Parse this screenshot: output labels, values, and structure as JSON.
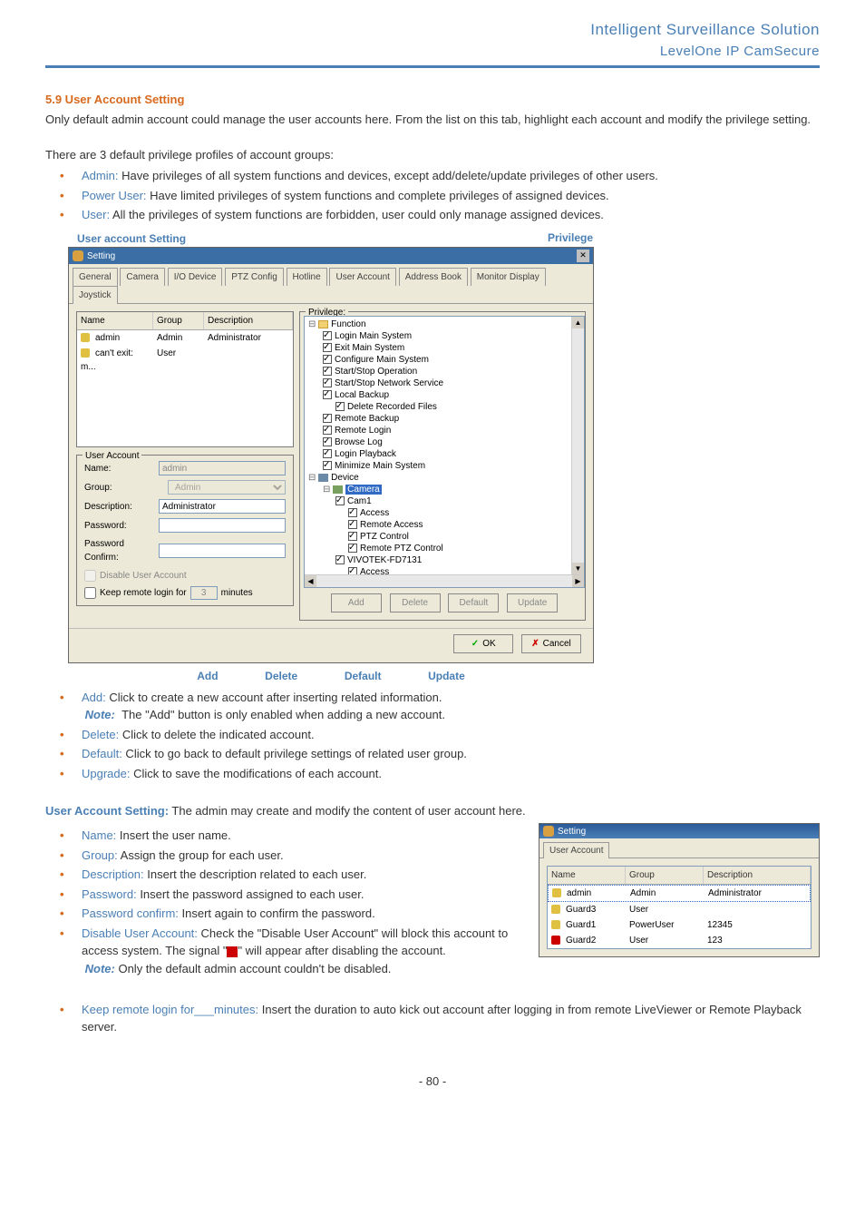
{
  "header": {
    "title": "Intelligent Surveillance Solution",
    "subtitle": "LevelOne IP CamSecure"
  },
  "section": {
    "heading": "5.9 User Account Setting",
    "intro": "Only default admin account could manage the user accounts here. From the list on this tab, highlight each account and modify the privilege setting.",
    "groups_intro": "There are 3 default privilege profiles of account groups:",
    "groups": [
      {
        "name": "Admin:",
        "desc": " Have privileges of all system functions and devices, except add/delete/update privileges of other users."
      },
      {
        "name": "Power User:",
        "desc": " Have limited privileges of system functions and complete privileges of assigned devices."
      },
      {
        "name": "User:",
        "desc": " All the privileges of system functions are forbidden, user could only manage assigned devices."
      }
    ]
  },
  "fig_labels": {
    "uas": "User account Setting",
    "priv": "Privilege",
    "add": "Add",
    "del": "Delete",
    "def": "Default",
    "upd": "Update"
  },
  "dialog": {
    "title": "Setting",
    "close": "✕",
    "tabs": [
      "General",
      "Camera",
      "I/O Device",
      "PTZ Config",
      "Hotline",
      "User Account",
      "Address Book",
      "Monitor Display",
      "Joystick"
    ],
    "active_tab": 5,
    "list": {
      "headers": {
        "name": "Name",
        "group": "Group",
        "desc": "Description"
      },
      "rows": [
        {
          "name": "admin",
          "group": "Admin",
          "desc": "Administrator"
        },
        {
          "name": "can't exit: m...",
          "group": "User",
          "desc": ""
        }
      ]
    },
    "form": {
      "legend": "User Account",
      "name_label": "Name:",
      "name_val": "admin",
      "group_label": "Group:",
      "group_val": "Admin",
      "desc_label": "Description:",
      "desc_val": "Administrator",
      "pwd_label": "Password:",
      "pwdc_label": "Password Confirm:",
      "disable_label": "Disable User Account",
      "keep_label_pre": "Keep remote login for",
      "keep_val": "3",
      "keep_label_post": "minutes"
    },
    "privilege": {
      "legend": "Privilege:",
      "tree": [
        {
          "indent": 0,
          "type": "folder",
          "label": "Function",
          "open": true
        },
        {
          "indent": 1,
          "type": "chk",
          "checked": true,
          "label": "Login Main System"
        },
        {
          "indent": 1,
          "type": "chk",
          "checked": true,
          "label": "Exit Main System"
        },
        {
          "indent": 1,
          "type": "chk",
          "checked": true,
          "label": "Configure Main System"
        },
        {
          "indent": 1,
          "type": "chk",
          "checked": true,
          "label": "Start/Stop Operation"
        },
        {
          "indent": 1,
          "type": "chk",
          "checked": true,
          "label": "Start/Stop Network Service"
        },
        {
          "indent": 1,
          "type": "chk",
          "checked": true,
          "label": "Local Backup",
          "open": true
        },
        {
          "indent": 2,
          "type": "chk",
          "checked": true,
          "label": "Delete Recorded Files"
        },
        {
          "indent": 1,
          "type": "chk",
          "checked": true,
          "label": "Remote Backup"
        },
        {
          "indent": 1,
          "type": "chk",
          "checked": true,
          "label": "Remote Login"
        },
        {
          "indent": 1,
          "type": "chk",
          "checked": true,
          "label": "Browse Log"
        },
        {
          "indent": 1,
          "type": "chk",
          "checked": true,
          "label": "Login Playback"
        },
        {
          "indent": 1,
          "type": "chk",
          "checked": true,
          "label": "Minimize Main System"
        },
        {
          "indent": 0,
          "type": "dev",
          "label": "Device",
          "open": true
        },
        {
          "indent": 1,
          "type": "camera",
          "label": "Camera",
          "selected": true
        },
        {
          "indent": 2,
          "type": "chk",
          "checked": true,
          "label": "Cam1",
          "open": true
        },
        {
          "indent": 3,
          "type": "chk",
          "checked": true,
          "label": "Access"
        },
        {
          "indent": 3,
          "type": "chk",
          "checked": true,
          "label": "Remote Access"
        },
        {
          "indent": 3,
          "type": "chk",
          "checked": true,
          "label": "PTZ Control"
        },
        {
          "indent": 3,
          "type": "chk",
          "checked": true,
          "label": "Remote PTZ Control"
        },
        {
          "indent": 2,
          "type": "chk",
          "checked": true,
          "label": "VIVOTEK-FD7131",
          "open": true
        },
        {
          "indent": 3,
          "type": "chk",
          "checked": true,
          "label": "Access"
        }
      ]
    },
    "buttons": {
      "add": "Add",
      "del": "Delete",
      "def": "Default",
      "upd": "Update",
      "ok": "OK",
      "cancel": "Cancel"
    }
  },
  "actions": {
    "items": [
      {
        "name": "Add:",
        "desc": " Click to create a new account after inserting related information.",
        "note": "The \"Add\" button is only enabled when adding a new account."
      },
      {
        "name": "Delete:",
        "desc": " Click to delete the indicated account."
      },
      {
        "name": "Default:",
        "desc": " Click to go back to default privilege settings of related user group."
      },
      {
        "name": "Upgrade:",
        "desc": " Click to save the modifications of each account."
      }
    ]
  },
  "uas_detail": {
    "heading": "User Account Setting:",
    "heading_rest": " The admin may create and modify the content of user account here.",
    "items": [
      {
        "name": "Name:",
        "desc": " Insert the user name."
      },
      {
        "name": "Group:",
        "desc": " Assign the group for each user."
      },
      {
        "name": "Description:",
        "desc": " Insert the description related to each user."
      },
      {
        "name": "Password:",
        "desc": " Insert the password assigned to each user."
      },
      {
        "name": "Password confirm:",
        "desc": " Insert again to confirm the password."
      },
      {
        "name": "Disable User Account:",
        "desc": " Check the \"Disable User Account\" will block this account to access system. The signal \"",
        "desc2": "\" will appear after disabling the account.",
        "note": "Only the default admin account couldn't be disabled."
      }
    ]
  },
  "keep_item": {
    "name": "Keep remote login for___minutes:",
    "desc": " Insert the duration to auto kick out account after logging in from remote LiveViewer or Remote Playback server."
  },
  "inset": {
    "title": "Setting",
    "tab": "User Account",
    "headers": {
      "name": "Name",
      "group": "Group",
      "desc": "Description"
    },
    "rows": [
      {
        "name": "admin",
        "group": "Admin",
        "desc": "Administrator"
      },
      {
        "name": "Guard3",
        "group": "User",
        "desc": ""
      },
      {
        "name": "Guard1",
        "group": "PowerUser",
        "desc": "12345"
      },
      {
        "name": "Guard2",
        "group": "User",
        "desc": "123"
      }
    ]
  },
  "note_label": "Note:",
  "page_number": "- 80 -"
}
